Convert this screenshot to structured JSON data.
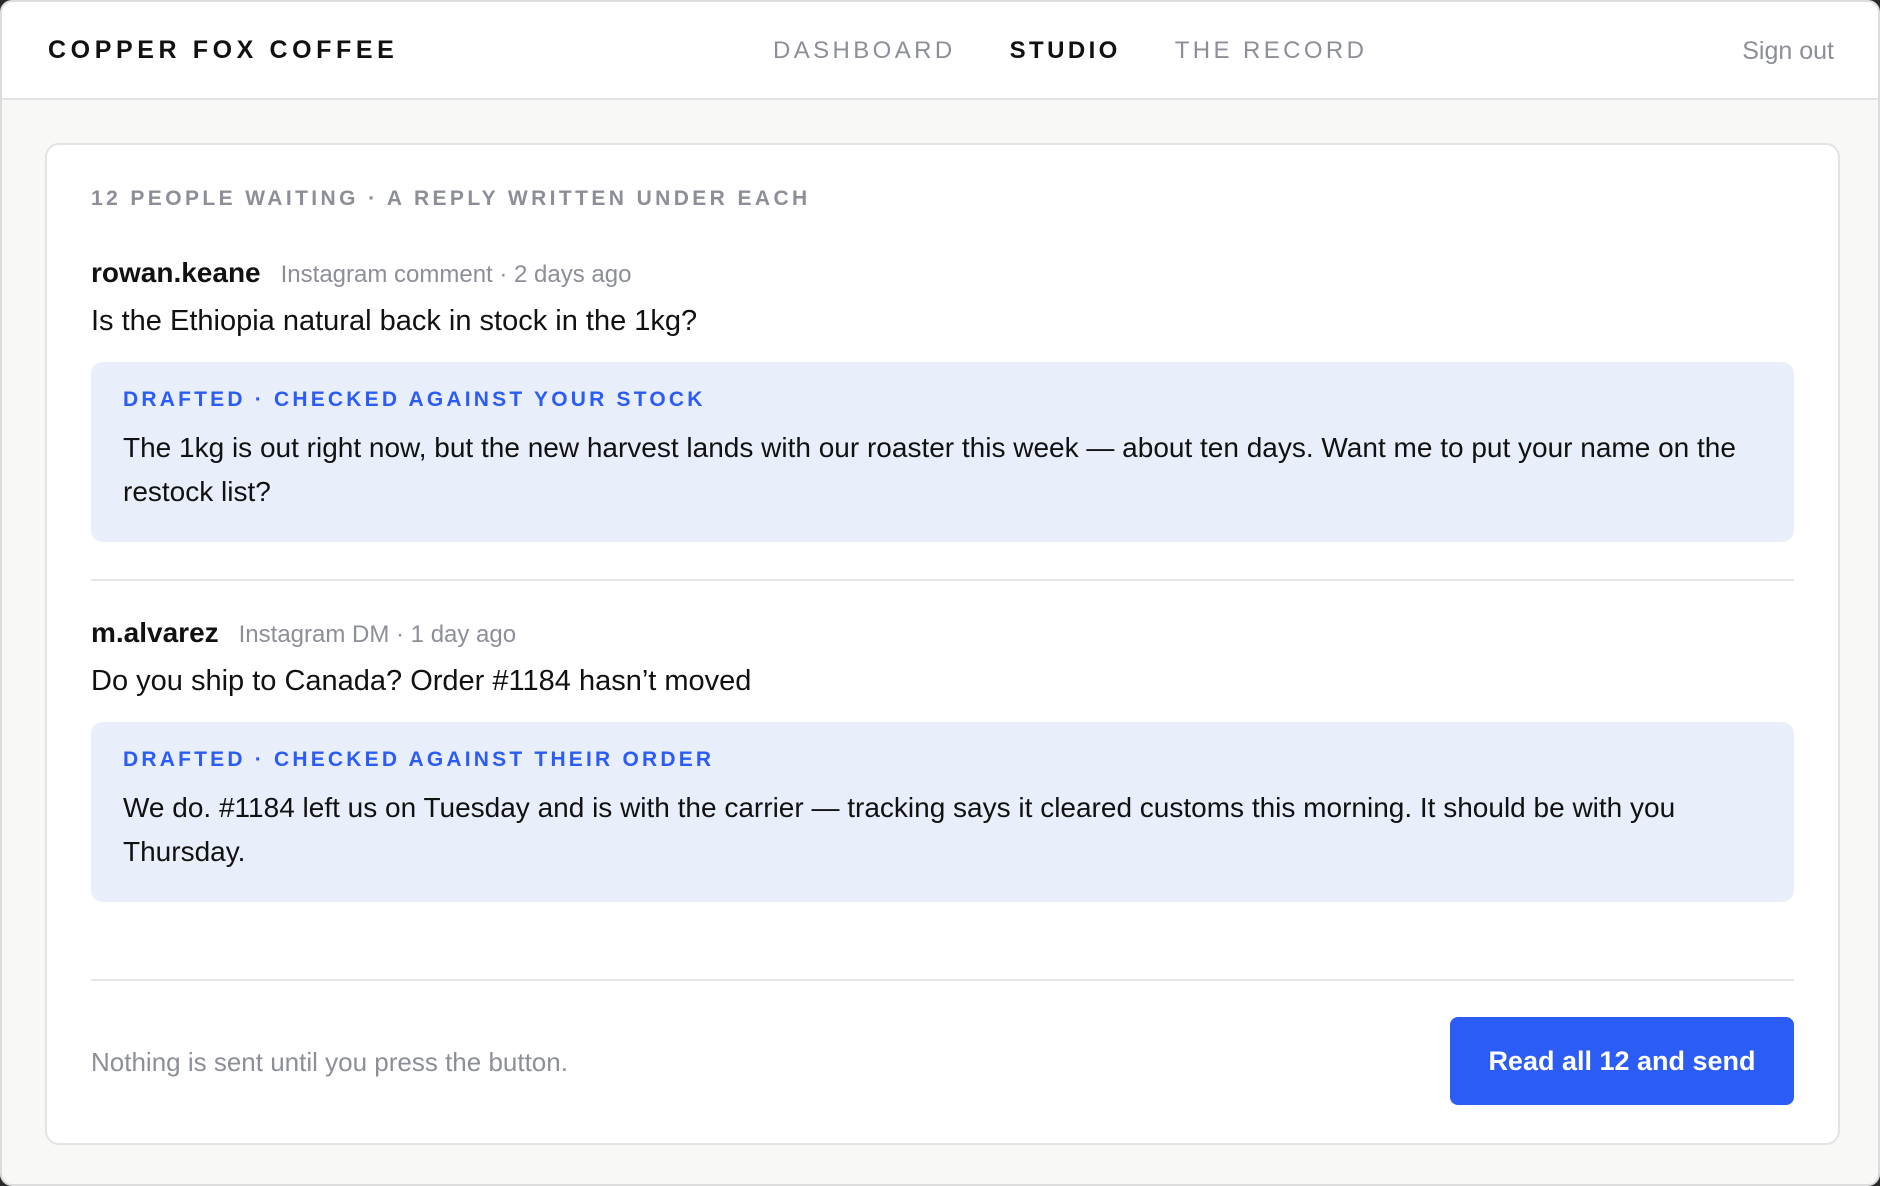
{
  "header": {
    "brand": "COPPER FOX COFFEE",
    "nav": [
      {
        "label": "DASHBOARD",
        "active": false
      },
      {
        "label": "STUDIO",
        "active": true
      },
      {
        "label": "THE RECORD",
        "active": false
      }
    ],
    "sign_out": "Sign out"
  },
  "queue": {
    "summary": "12 PEOPLE WAITING · A REPLY WRITTEN UNDER EACH",
    "messages": [
      {
        "handle": "rowan.keane",
        "meta": "Instagram comment · 2 days ago",
        "question": "Is the Ethiopia natural back in stock in the 1kg?",
        "draft_label": "DRAFTED · CHECKED AGAINST YOUR STOCK",
        "draft_text": "The 1kg is out right now, but the new harvest lands with our roaster this week — about ten days. Want me to put your name on the restock list?"
      },
      {
        "handle": "m.alvarez",
        "meta": "Instagram DM · 1 day ago",
        "question": "Do you ship to Canada? Order #1184 hasn’t moved",
        "draft_label": "DRAFTED · CHECKED AGAINST THEIR ORDER",
        "draft_text": "We do. #1184 left us on Tuesday and is with the carrier — tracking says it cleared customs this morning. It should be with you Thursday."
      }
    ]
  },
  "footer": {
    "note": "Nothing is sent until you press the button.",
    "send_label": "Read all 12 and send"
  },
  "colors": {
    "accent": "#2b5cf6",
    "draft_background": "#e9eefb",
    "muted_text": "#8c8f98"
  }
}
